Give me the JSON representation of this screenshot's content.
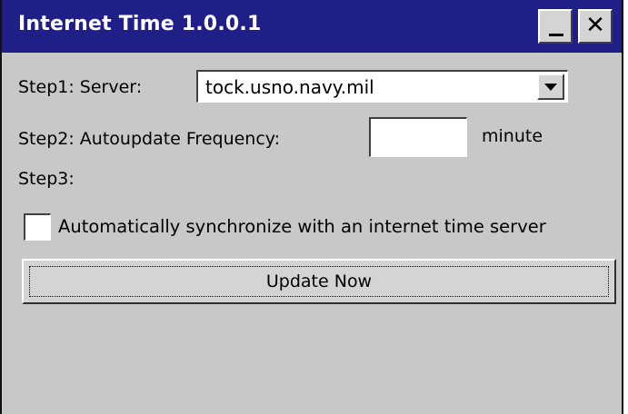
{
  "window": {
    "title": "Internet Time 1.0.0.1",
    "minimize_icon": "minimize-icon",
    "close_icon": "close-icon",
    "close_glyph": "✕"
  },
  "step1": {
    "label": "Step1: Server:",
    "server_value": "tock.usno.navy.mil",
    "dropdown_icon": "chevron-down-icon"
  },
  "step2": {
    "label": "Step2: Autoupdate Frequency:",
    "frequency_value": "",
    "unit": "minute"
  },
  "step3": {
    "label": "Step3:"
  },
  "sync": {
    "checkbox_label": "Automatically synchronize with an internet time server",
    "checked": false
  },
  "actions": {
    "update_label": "Update Now"
  },
  "colors": {
    "titlebar": "#1f1f87",
    "window_bg": "#c8c8c8",
    "button_face": "#d4d4d4"
  }
}
